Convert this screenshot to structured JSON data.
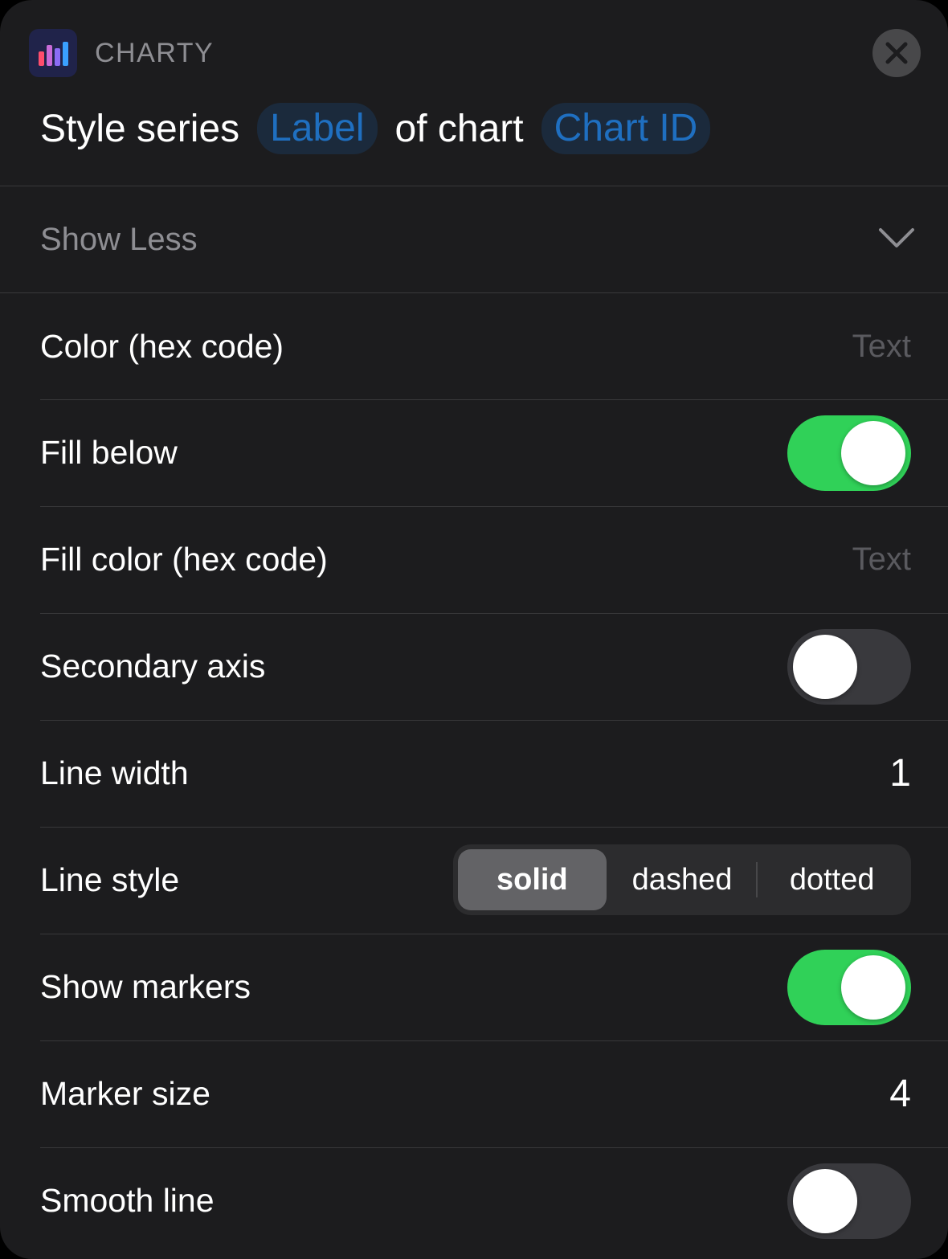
{
  "app": {
    "name": "CHARTY",
    "icon": "bar-chart-icon",
    "icon_colors": [
      "#ff4d6d",
      "#b06cf5",
      "#3aa0ff"
    ]
  },
  "header": {
    "title_prefix": "Style series",
    "label_token": "Label",
    "title_middle": "of chart",
    "chart_token": "Chart ID",
    "close_icon": "close-icon"
  },
  "show_less": {
    "label": "Show Less",
    "icon": "chevron-down-icon"
  },
  "params": {
    "color": {
      "label": "Color (hex code)",
      "placeholder": "Text"
    },
    "fill_below": {
      "label": "Fill below",
      "value": true
    },
    "fill_color": {
      "label": "Fill color (hex code)",
      "placeholder": "Text"
    },
    "secondary_axis": {
      "label": "Secondary axis",
      "value": false
    },
    "line_width": {
      "label": "Line width",
      "value": "1"
    },
    "line_style": {
      "label": "Line style",
      "options": [
        "solid",
        "dashed",
        "dotted"
      ],
      "selected": "solid"
    },
    "show_markers": {
      "label": "Show markers",
      "value": true
    },
    "marker_size": {
      "label": "Marker size",
      "value": "4"
    },
    "smooth_line": {
      "label": "Smooth line",
      "value": false
    }
  },
  "colors": {
    "background": "#1c1c1e",
    "token_text": "#1f6fc0",
    "toggle_on": "#30d158",
    "toggle_off": "#39393d"
  }
}
